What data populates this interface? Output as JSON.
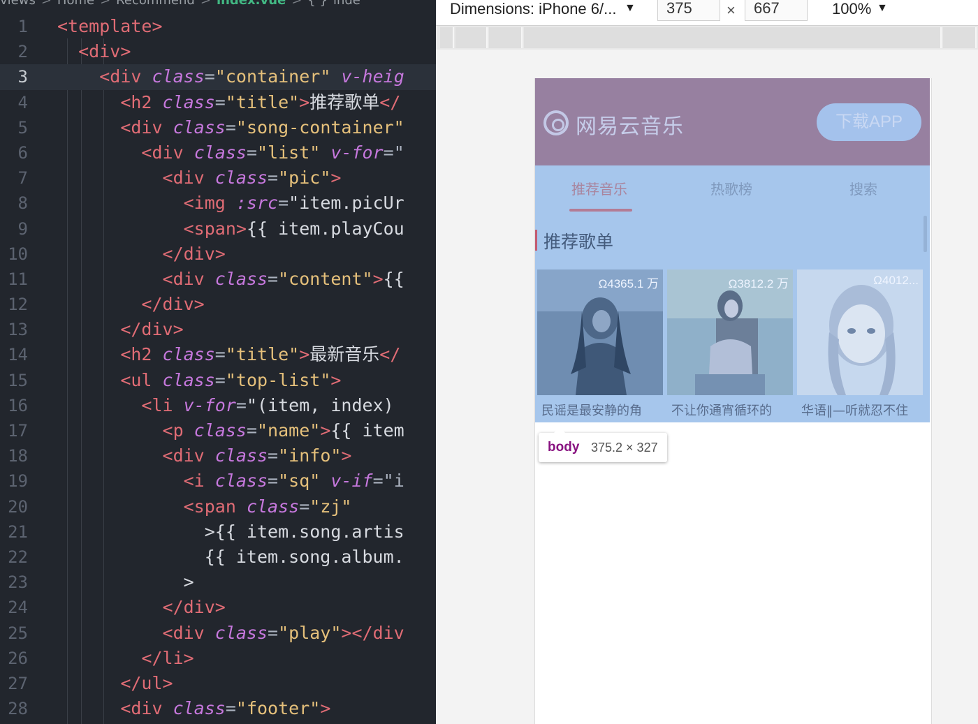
{
  "editor": {
    "breadcrumb": [
      "views",
      ">",
      "Home",
      ">",
      "Recommend",
      ">",
      "index.vue",
      ">",
      "{ }",
      "inde"
    ],
    "lines": [
      {
        "n": "1",
        "parts": [
          [
            "t",
            "<template>"
          ]
        ]
      },
      {
        "n": "2",
        "parts": [
          [
            "tx",
            "  "
          ],
          [
            "t",
            "<div>"
          ]
        ]
      },
      {
        "n": "3",
        "active": true,
        "parts": [
          [
            "tx",
            "    "
          ],
          [
            "t",
            "<div "
          ],
          [
            "a",
            "class"
          ],
          [
            "p",
            "="
          ],
          [
            "s",
            "\"container\""
          ],
          [
            "tx",
            " "
          ],
          [
            "a",
            "v-heig"
          ]
        ]
      },
      {
        "n": "4",
        "parts": [
          [
            "tx",
            "      "
          ],
          [
            "t",
            "<h2 "
          ],
          [
            "a",
            "class"
          ],
          [
            "p",
            "="
          ],
          [
            "s",
            "\"title\""
          ],
          [
            "t",
            ">"
          ],
          [
            "tx",
            "推荐歌单"
          ],
          [
            "t",
            "</"
          ]
        ]
      },
      {
        "n": "5",
        "parts": [
          [
            "tx",
            "      "
          ],
          [
            "t",
            "<div "
          ],
          [
            "a",
            "class"
          ],
          [
            "p",
            "="
          ],
          [
            "s",
            "\"song-container\""
          ]
        ]
      },
      {
        "n": "6",
        "parts": [
          [
            "tx",
            "        "
          ],
          [
            "t",
            "<div "
          ],
          [
            "a",
            "class"
          ],
          [
            "p",
            "="
          ],
          [
            "s",
            "\"list\""
          ],
          [
            "tx",
            " "
          ],
          [
            "a",
            "v-for"
          ],
          [
            "p",
            "=\""
          ]
        ]
      },
      {
        "n": "7",
        "parts": [
          [
            "tx",
            "          "
          ],
          [
            "t",
            "<div "
          ],
          [
            "a",
            "class"
          ],
          [
            "p",
            "="
          ],
          [
            "s",
            "\"pic\""
          ],
          [
            "t",
            ">"
          ]
        ]
      },
      {
        "n": "8",
        "parts": [
          [
            "tx",
            "            "
          ],
          [
            "t",
            "<img "
          ],
          [
            "a",
            ":src"
          ],
          [
            "p",
            "="
          ],
          [
            "tx",
            "\"item.picUr"
          ]
        ]
      },
      {
        "n": "9",
        "parts": [
          [
            "tx",
            "            "
          ],
          [
            "t",
            "<span>"
          ],
          [
            "tx",
            "{{ item.playCou"
          ]
        ]
      },
      {
        "n": "10",
        "parts": [
          [
            "tx",
            "          "
          ],
          [
            "t",
            "</div>"
          ]
        ]
      },
      {
        "n": "11",
        "parts": [
          [
            "tx",
            "          "
          ],
          [
            "t",
            "<div "
          ],
          [
            "a",
            "class"
          ],
          [
            "p",
            "="
          ],
          [
            "s",
            "\"content\""
          ],
          [
            "t",
            ">"
          ],
          [
            "tx",
            "{{"
          ]
        ]
      },
      {
        "n": "12",
        "parts": [
          [
            "tx",
            "        "
          ],
          [
            "t",
            "</div>"
          ]
        ]
      },
      {
        "n": "13",
        "parts": [
          [
            "tx",
            "      "
          ],
          [
            "t",
            "</div>"
          ]
        ]
      },
      {
        "n": "14",
        "parts": [
          [
            "tx",
            "      "
          ],
          [
            "t",
            "<h2 "
          ],
          [
            "a",
            "class"
          ],
          [
            "p",
            "="
          ],
          [
            "s",
            "\"title\""
          ],
          [
            "t",
            ">"
          ],
          [
            "tx",
            "最新音乐"
          ],
          [
            "t",
            "</"
          ]
        ]
      },
      {
        "n": "15",
        "parts": [
          [
            "tx",
            "      "
          ],
          [
            "t",
            "<ul "
          ],
          [
            "a",
            "class"
          ],
          [
            "p",
            "="
          ],
          [
            "s",
            "\"top-list\""
          ],
          [
            "t",
            ">"
          ]
        ]
      },
      {
        "n": "16",
        "parts": [
          [
            "tx",
            "        "
          ],
          [
            "t",
            "<li "
          ],
          [
            "a",
            "v-for"
          ],
          [
            "p",
            "="
          ],
          [
            "tx",
            "\"(item, index)"
          ]
        ]
      },
      {
        "n": "17",
        "parts": [
          [
            "tx",
            "          "
          ],
          [
            "t",
            "<p "
          ],
          [
            "a",
            "class"
          ],
          [
            "p",
            "="
          ],
          [
            "s",
            "\"name\""
          ],
          [
            "t",
            ">"
          ],
          [
            "tx",
            "{{ item"
          ]
        ]
      },
      {
        "n": "18",
        "parts": [
          [
            "tx",
            "          "
          ],
          [
            "t",
            "<div "
          ],
          [
            "a",
            "class"
          ],
          [
            "p",
            "="
          ],
          [
            "s",
            "\"info\""
          ],
          [
            "t",
            ">"
          ]
        ]
      },
      {
        "n": "19",
        "parts": [
          [
            "tx",
            "            "
          ],
          [
            "t",
            "<i "
          ],
          [
            "a",
            "class"
          ],
          [
            "p",
            "="
          ],
          [
            "s",
            "\"sq\""
          ],
          [
            "tx",
            " "
          ],
          [
            "a",
            "v-if"
          ],
          [
            "p",
            "=\"i"
          ]
        ]
      },
      {
        "n": "20",
        "parts": [
          [
            "tx",
            "            "
          ],
          [
            "t",
            "<span "
          ],
          [
            "a",
            "class"
          ],
          [
            "p",
            "="
          ],
          [
            "s",
            "\"zj\""
          ]
        ]
      },
      {
        "n": "21",
        "parts": [
          [
            "tx",
            "              >{{ item.song.artis"
          ]
        ]
      },
      {
        "n": "22",
        "parts": [
          [
            "tx",
            "              {{ item.song.album."
          ]
        ]
      },
      {
        "n": "23",
        "parts": [
          [
            "tx",
            "            >"
          ]
        ]
      },
      {
        "n": "24",
        "parts": [
          [
            "tx",
            "          "
          ],
          [
            "t",
            "</div>"
          ]
        ]
      },
      {
        "n": "25",
        "parts": [
          [
            "tx",
            "          "
          ],
          [
            "t",
            "<div "
          ],
          [
            "a",
            "class"
          ],
          [
            "p",
            "="
          ],
          [
            "s",
            "\"play\""
          ],
          [
            "t",
            "></div"
          ]
        ]
      },
      {
        "n": "26",
        "parts": [
          [
            "tx",
            "        "
          ],
          [
            "t",
            "</li>"
          ]
        ]
      },
      {
        "n": "27",
        "parts": [
          [
            "tx",
            "      "
          ],
          [
            "t",
            "</ul>"
          ]
        ]
      },
      {
        "n": "28",
        "parts": [
          [
            "tx",
            "      "
          ],
          [
            "t",
            "<div "
          ],
          [
            "a",
            "class"
          ],
          [
            "p",
            "="
          ],
          [
            "s",
            "\"footer\""
          ],
          [
            "t",
            ">"
          ]
        ]
      }
    ]
  },
  "devtools": {
    "dimensions_label": "Dimensions: iPhone 6/...",
    "width": "375",
    "times": "×",
    "height": "667",
    "zoom": "100%"
  },
  "app": {
    "brand": "网易云音乐",
    "download_label": "下载APP",
    "tabs": [
      {
        "label": "推荐音乐",
        "active": true
      },
      {
        "label": "热歌榜",
        "active": false
      },
      {
        "label": "搜索",
        "active": false
      }
    ],
    "section_title": "推荐歌单",
    "playlists": [
      {
        "count": "Ω4365.1 万",
        "title": "民谣是最安静的角"
      },
      {
        "count": "Ω3812.2 万",
        "title": "不让你通宵循环的"
      },
      {
        "count": "Ω4012...",
        "title": "华语‖—听就忍不住"
      }
    ]
  },
  "inspector_tooltip": {
    "tag": "body",
    "size": "375.2 × 327"
  },
  "colors": {
    "header_bg": "#9780a0",
    "highlight_overlay": "#a6c6ec",
    "active_tab": "#a9849d"
  }
}
